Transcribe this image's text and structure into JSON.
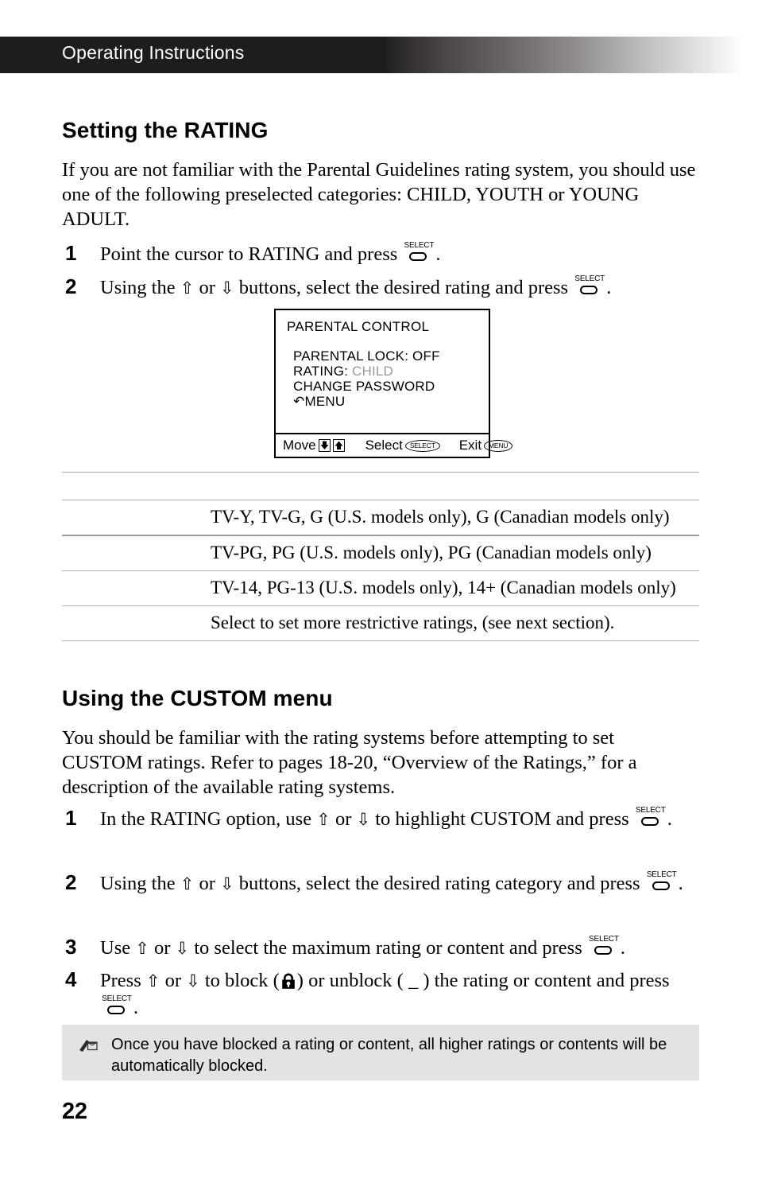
{
  "header": {
    "title": "Operating Instructions"
  },
  "sections": {
    "rating": {
      "heading": "Setting the RATING",
      "intro": "If you are not familiar with the Parental Guidelines rating system, you should use one of the following preselected categories: CHILD, YOUTH or YOUNG ADULT.",
      "steps": [
        {
          "num": "1",
          "before": "Point the cursor to RATING and press ",
          "after": "."
        },
        {
          "num": "2",
          "before_a": "Using the ",
          "arrow_up": "⇧",
          "mid": " or ",
          "arrow_down": "⇩",
          "before_b": " buttons, select the desired rating and press ",
          "after": "."
        }
      ]
    },
    "custom": {
      "heading": "Using the CUSTOM menu",
      "intro": "You should be familiar with the rating systems before attempting to set CUSTOM ratings. Refer to pages 18-20, “Overview of the Ratings,” for a description of the available rating systems.",
      "steps": [
        {
          "num": "1",
          "p1": "In the RATING option, use ",
          "up": "⇧",
          "p2": " or ",
          "down": "⇩",
          "p3": " to highlight CUSTOM and press ",
          "p4": "."
        },
        {
          "num": "2",
          "p1": "Using the ",
          "up": "⇧",
          "p2": " or ",
          "down": "⇩",
          "p3": " buttons, select the desired rating category and press ",
          "p4": "."
        },
        {
          "num": "3",
          "p1": "Use ",
          "up": "⇧",
          "p2": " or ",
          "down": "⇩",
          "p3": " to select the maximum rating or content and press ",
          "p4": "."
        },
        {
          "num": "4",
          "p1": "Press ",
          "up": "⇧",
          "p2": " or ",
          "down": "⇩",
          "p3": " to block (",
          "p3b": ") or unblock ( _ ) the rating or content and press ",
          "p4": "."
        }
      ]
    }
  },
  "osd": {
    "title": "PARENTAL CONTROL",
    "items": [
      {
        "label": "PARENTAL LOCK: OFF",
        "value": "",
        "dim": false
      },
      {
        "label": "RATING: ",
        "value": "CHILD",
        "dim": true
      },
      {
        "label": "CHANGE PASSWORD",
        "value": "",
        "dim": false
      },
      {
        "label": "MENU",
        "value": "",
        "dim": false,
        "return_glyph": "↶"
      }
    ],
    "footer": {
      "move_label": "Move",
      "select_label": "Select",
      "select_button": "SELECT",
      "exit_label": "Exit",
      "exit_button": "MENU"
    }
  },
  "ratings_table": {
    "rows": [
      {
        "label": "",
        "desc": "TV-Y, TV-G, G (U.S. models only), G (Canadian models only)"
      },
      {
        "label": "",
        "desc": "TV-PG, PG (U.S. models only), PG (Canadian models only)"
      },
      {
        "label": "",
        "desc": "TV-14, PG-13 (U.S. models only), 14+ (Canadian models only)"
      },
      {
        "label": "",
        "desc": "Select to set more restrictive ratings, (see next section)."
      }
    ]
  },
  "note": {
    "icon": "pencil-note-icon",
    "text": "Once you have blocked a rating or content, all higher ratings or contents will be automatically blocked."
  },
  "footer": {
    "page_number": "22"
  },
  "icons": {
    "select_button_label": "SELECT"
  },
  "colors": {
    "header_dark": "#1f1c1c",
    "note_bg": "#e3e3e3",
    "osd_dim": "#9a9a9a",
    "rule": "#aaaaaa"
  }
}
